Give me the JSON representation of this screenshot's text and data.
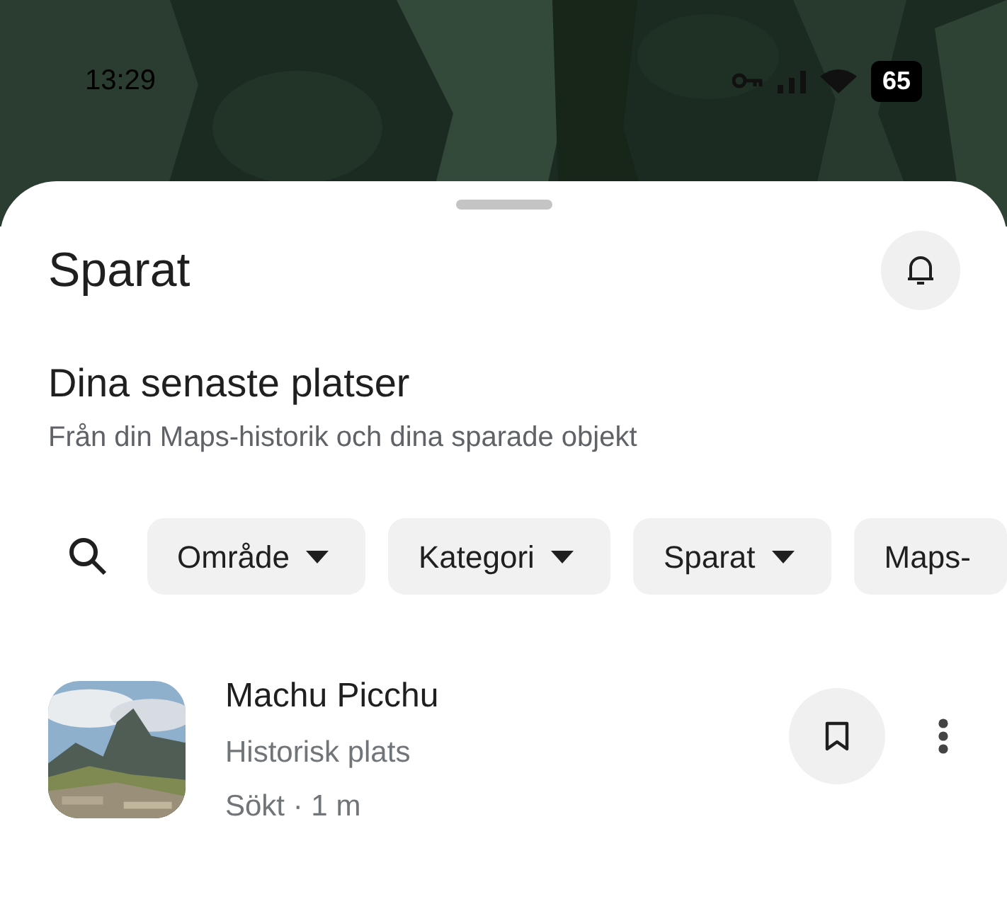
{
  "status_bar": {
    "time": "13:29",
    "battery": "65"
  },
  "sheet": {
    "title": "Sparat"
  },
  "section": {
    "title": "Dina senaste platser",
    "subtitle": "Från din Maps-historik och dina sparade objekt"
  },
  "filters": [
    {
      "label": "Område",
      "dropdown": true
    },
    {
      "label": "Kategori",
      "dropdown": true
    },
    {
      "label": "Sparat",
      "dropdown": true
    },
    {
      "label": "Maps-",
      "dropdown": false
    }
  ],
  "places": [
    {
      "name": "Machu Picchu",
      "category": "Historisk plats",
      "meta": "Sökt · 1 m",
      "saved": false
    }
  ]
}
